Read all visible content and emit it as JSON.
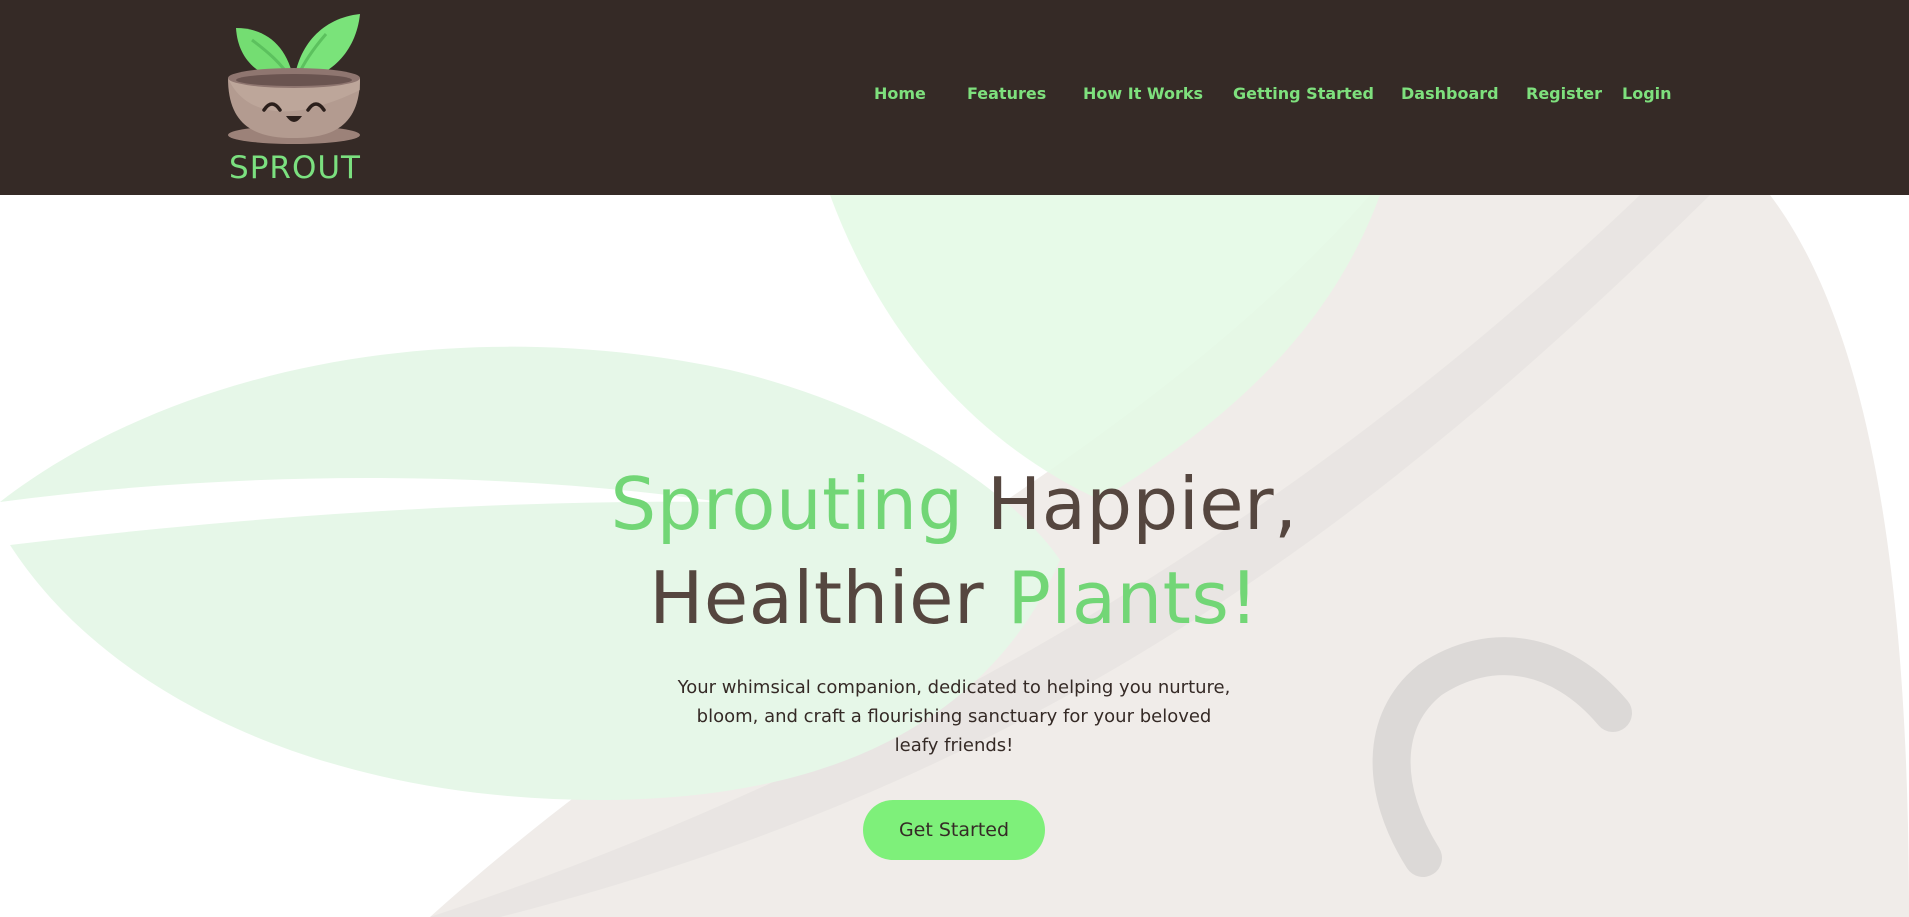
{
  "brand": {
    "name": "SPROUT",
    "colors": {
      "topbar": "#352a26",
      "accent_green": "#7be07f",
      "button_green": "#7ef07a",
      "text_brown": "#55463f"
    }
  },
  "nav": {
    "items": [
      {
        "label": "Home"
      },
      {
        "label": "Features"
      },
      {
        "label": "How It Works"
      },
      {
        "label": "Getting Started"
      },
      {
        "label": "Dashboard"
      },
      {
        "label": "Register"
      },
      {
        "label": "Login"
      }
    ]
  },
  "hero": {
    "headline": {
      "part1": "Sprouting",
      "part2": " Happier,",
      "part3": "Healthier ",
      "part4": "Plants!"
    },
    "subtitle": "Your whimsical companion, dedicated to helping you nurture, bloom, and craft a flourishing sanctuary for your beloved leafy friends!",
    "cta_label": "Get Started"
  },
  "icons": {
    "logo": "smiling-plant-pot-icon"
  }
}
